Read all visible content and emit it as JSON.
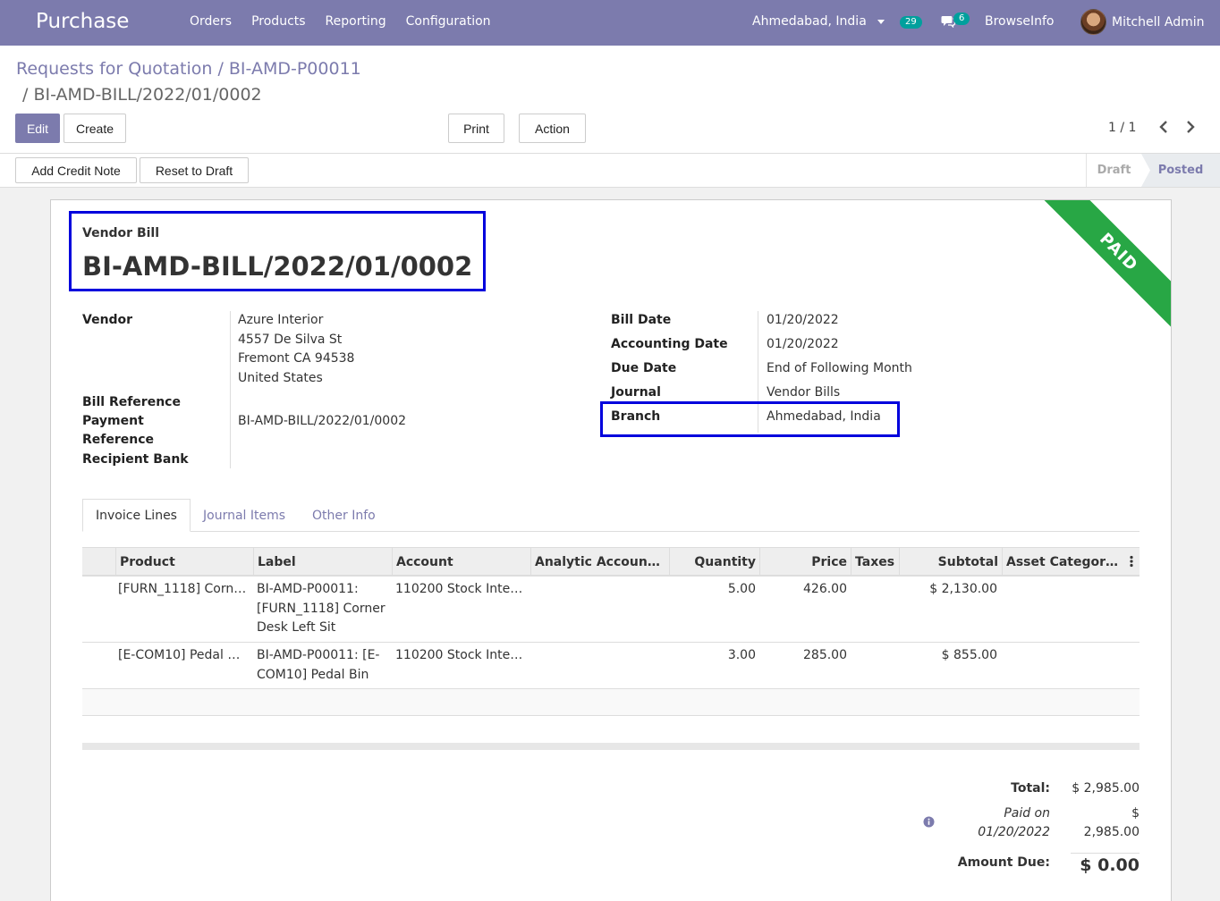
{
  "navbar": {
    "app_name": "Purchase",
    "menu": [
      "Orders",
      "Products",
      "Reporting",
      "Configuration"
    ],
    "branch": "Ahmedabad, India",
    "activity_count": "29",
    "message_count": "6",
    "company": "BrowseInfo",
    "user": "Mitchell Admin"
  },
  "breadcrumb": {
    "parent": "Requests for Quotation",
    "order": "BI-AMD-P00011",
    "current": "BI-AMD-BILL/2022/01/0002"
  },
  "toolbar": {
    "edit": "Edit",
    "create": "Create",
    "print": "Print",
    "action": "Action",
    "pager": "1 / 1"
  },
  "statusbar": {
    "add_credit_note": "Add Credit Note",
    "reset_to_draft": "Reset to Draft",
    "stages": [
      "Draft",
      "Posted"
    ],
    "active_stage": "Posted"
  },
  "sheet": {
    "ribbon": "PAID",
    "doc_type": "Vendor Bill",
    "doc_name": "BI-AMD-BILL/2022/01/0002",
    "left": {
      "vendor_label": "Vendor",
      "vendor_name": "Azure Interior",
      "vendor_address": [
        "4557 De Silva St",
        "Fremont CA 94538",
        "United States"
      ],
      "bill_ref_label": "Bill Reference",
      "payment_ref_label_1": "Payment",
      "payment_ref_label_2": "Reference",
      "payment_ref_value": "BI-AMD-BILL/2022/01/0002",
      "recipient_bank_label": "Recipient Bank"
    },
    "right": {
      "bill_date_label": "Bill Date",
      "bill_date": "01/20/2022",
      "accounting_date_label": "Accounting Date",
      "accounting_date": "01/20/2022",
      "due_date_label": "Due Date",
      "due_date": "End of Following Month",
      "journal_label": "Journal",
      "journal": "Vendor Bills",
      "branch_label": "Branch",
      "branch": "Ahmedabad, India"
    },
    "tabs": [
      "Invoice Lines",
      "Journal Items",
      "Other Info"
    ],
    "table": {
      "headers": [
        "Product",
        "Label",
        "Account",
        "Analytic Accoun…",
        "Quantity",
        "Price",
        "Taxes",
        "Subtotal",
        "Asset Categor…"
      ],
      "rows": [
        {
          "product": "[FURN_1118] Corn…",
          "label": [
            "BI-AMD-P00011:",
            "[FURN_1118] Corner",
            "Desk Left Sit"
          ],
          "account": "110200 Stock Inte…",
          "quantity": "5.00",
          "price": "426.00",
          "subtotal": "$ 2,130.00"
        },
        {
          "product": "[E-COM10] Pedal …",
          "label": [
            "BI-AMD-P00011: [E-",
            "COM10] Pedal Bin"
          ],
          "account": "110200 Stock Inte…",
          "quantity": "3.00",
          "price": "285.00",
          "subtotal": "$ 855.00"
        }
      ]
    },
    "totals": {
      "total_label": "Total:",
      "total": "$ 2,985.00",
      "paid_on_1": "Paid on",
      "paid_on_2": "01/20/2022",
      "paid_amount_1": "$",
      "paid_amount_2": "2,985.00",
      "amount_due_label": "Amount Due:",
      "amount_due": "$ 0.00"
    }
  },
  "colors": {
    "brand": "#7c7bad",
    "paid_ribbon": "#28a745",
    "badge": "#00a09d",
    "highlight": "#0000dd"
  }
}
